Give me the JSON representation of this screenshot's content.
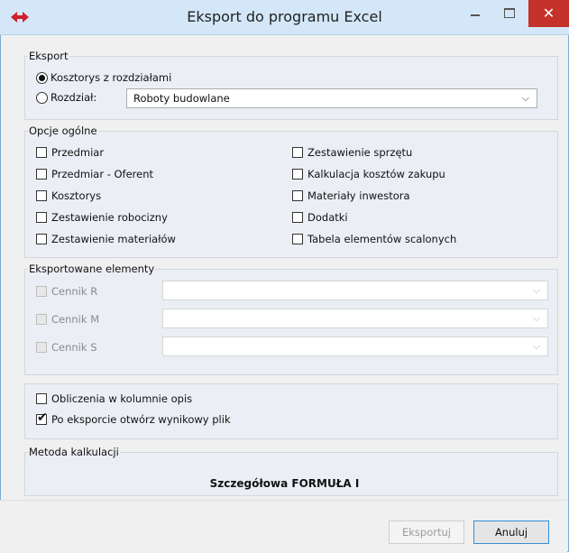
{
  "window": {
    "title": "Eksport do programu Excel",
    "close_glyph": "✕"
  },
  "eksport": {
    "legend": "Eksport",
    "option_full": "Kosztorys z rozdziałami",
    "option_chapter": "Rozdział:",
    "chapter_value": "Roboty budowlane"
  },
  "opcje": {
    "legend": "Opcje ogólne",
    "left": [
      "Przedmiar",
      "Przedmiar - Oferent",
      "Kosztorys",
      "Zestawienie robocizny",
      "Zestawienie materiałów"
    ],
    "right": [
      "Zestawienie sprzętu",
      "Kalkulacja kosztów zakupu",
      "Materiały inwestora",
      "Dodatki",
      "Tabela elementów scalonych"
    ]
  },
  "elementy": {
    "legend": "Eksportowane elementy",
    "items": [
      "Cennik R",
      "Cennik M",
      "Cennik S"
    ]
  },
  "extra": {
    "calc_in_desc": "Obliczenia w kolumnie opis",
    "open_after": "Po eksporcie otwórz wynikowy plik"
  },
  "metoda": {
    "legend": "Metoda kalkulacji",
    "value": "Szczegółowa FORMUŁA I"
  },
  "buttons": {
    "export": "Eksportuj",
    "cancel": "Anuluj"
  }
}
